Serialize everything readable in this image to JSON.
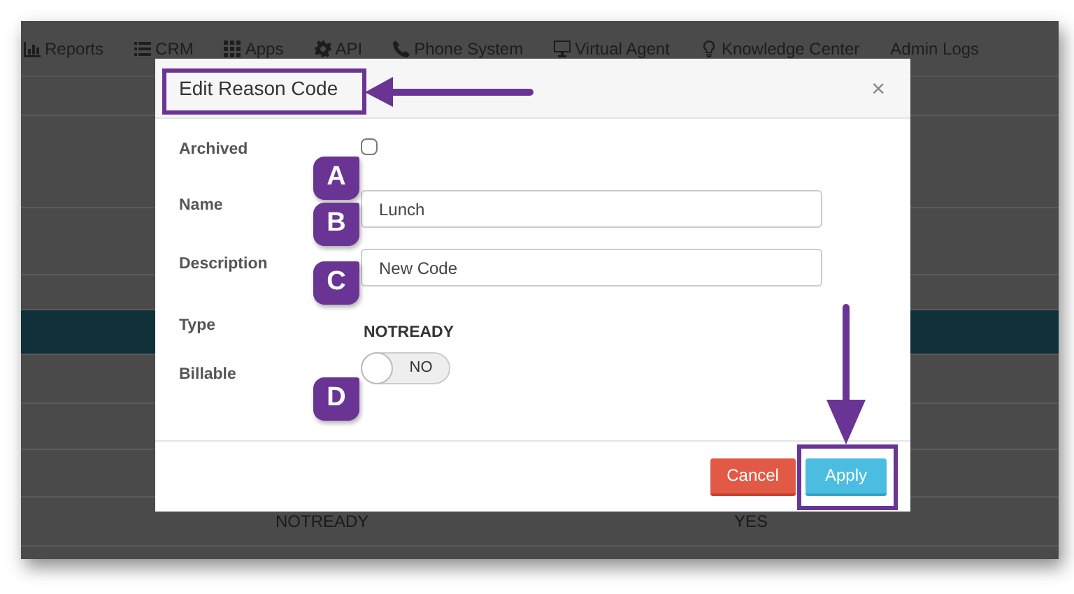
{
  "nav": [
    {
      "label": "Reports"
    },
    {
      "label": "CRM"
    },
    {
      "label": "Apps"
    },
    {
      "label": "API"
    },
    {
      "label": "Phone System"
    },
    {
      "label": "Virtual Agent"
    },
    {
      "label": "Knowledge Center"
    },
    {
      "label": "Admin Logs"
    }
  ],
  "background_rows": [
    {
      "highlighted": false
    },
    {
      "highlighted": false
    },
    {
      "highlighted": false
    },
    {
      "highlighted": false
    },
    {
      "highlighted": true
    },
    {
      "highlighted": false
    },
    {
      "highlighted": false
    },
    {
      "highlighted": false
    },
    {
      "highlighted": false,
      "cells": [
        "NOTREADY",
        "YES"
      ]
    }
  ],
  "modal": {
    "title": "Edit Reason Code",
    "close": "×",
    "fields": [
      {
        "kind": "checkbox",
        "label": "Archived",
        "checked": false
      },
      {
        "kind": "text",
        "label": "Name",
        "value": "Lunch"
      },
      {
        "kind": "text",
        "label": "Description",
        "value": "New Code"
      },
      {
        "kind": "static",
        "label": "Type",
        "value": "NOTREADY"
      },
      {
        "kind": "toggle",
        "label": "Billable",
        "on": false,
        "value": "NO"
      }
    ],
    "buttons": [
      {
        "kind": "cancel",
        "label": "Cancel"
      },
      {
        "kind": "apply",
        "label": "Apply"
      }
    ]
  },
  "callouts": [
    {
      "label": "A"
    },
    {
      "label": "B"
    },
    {
      "label": "C"
    },
    {
      "label": "D"
    }
  ]
}
